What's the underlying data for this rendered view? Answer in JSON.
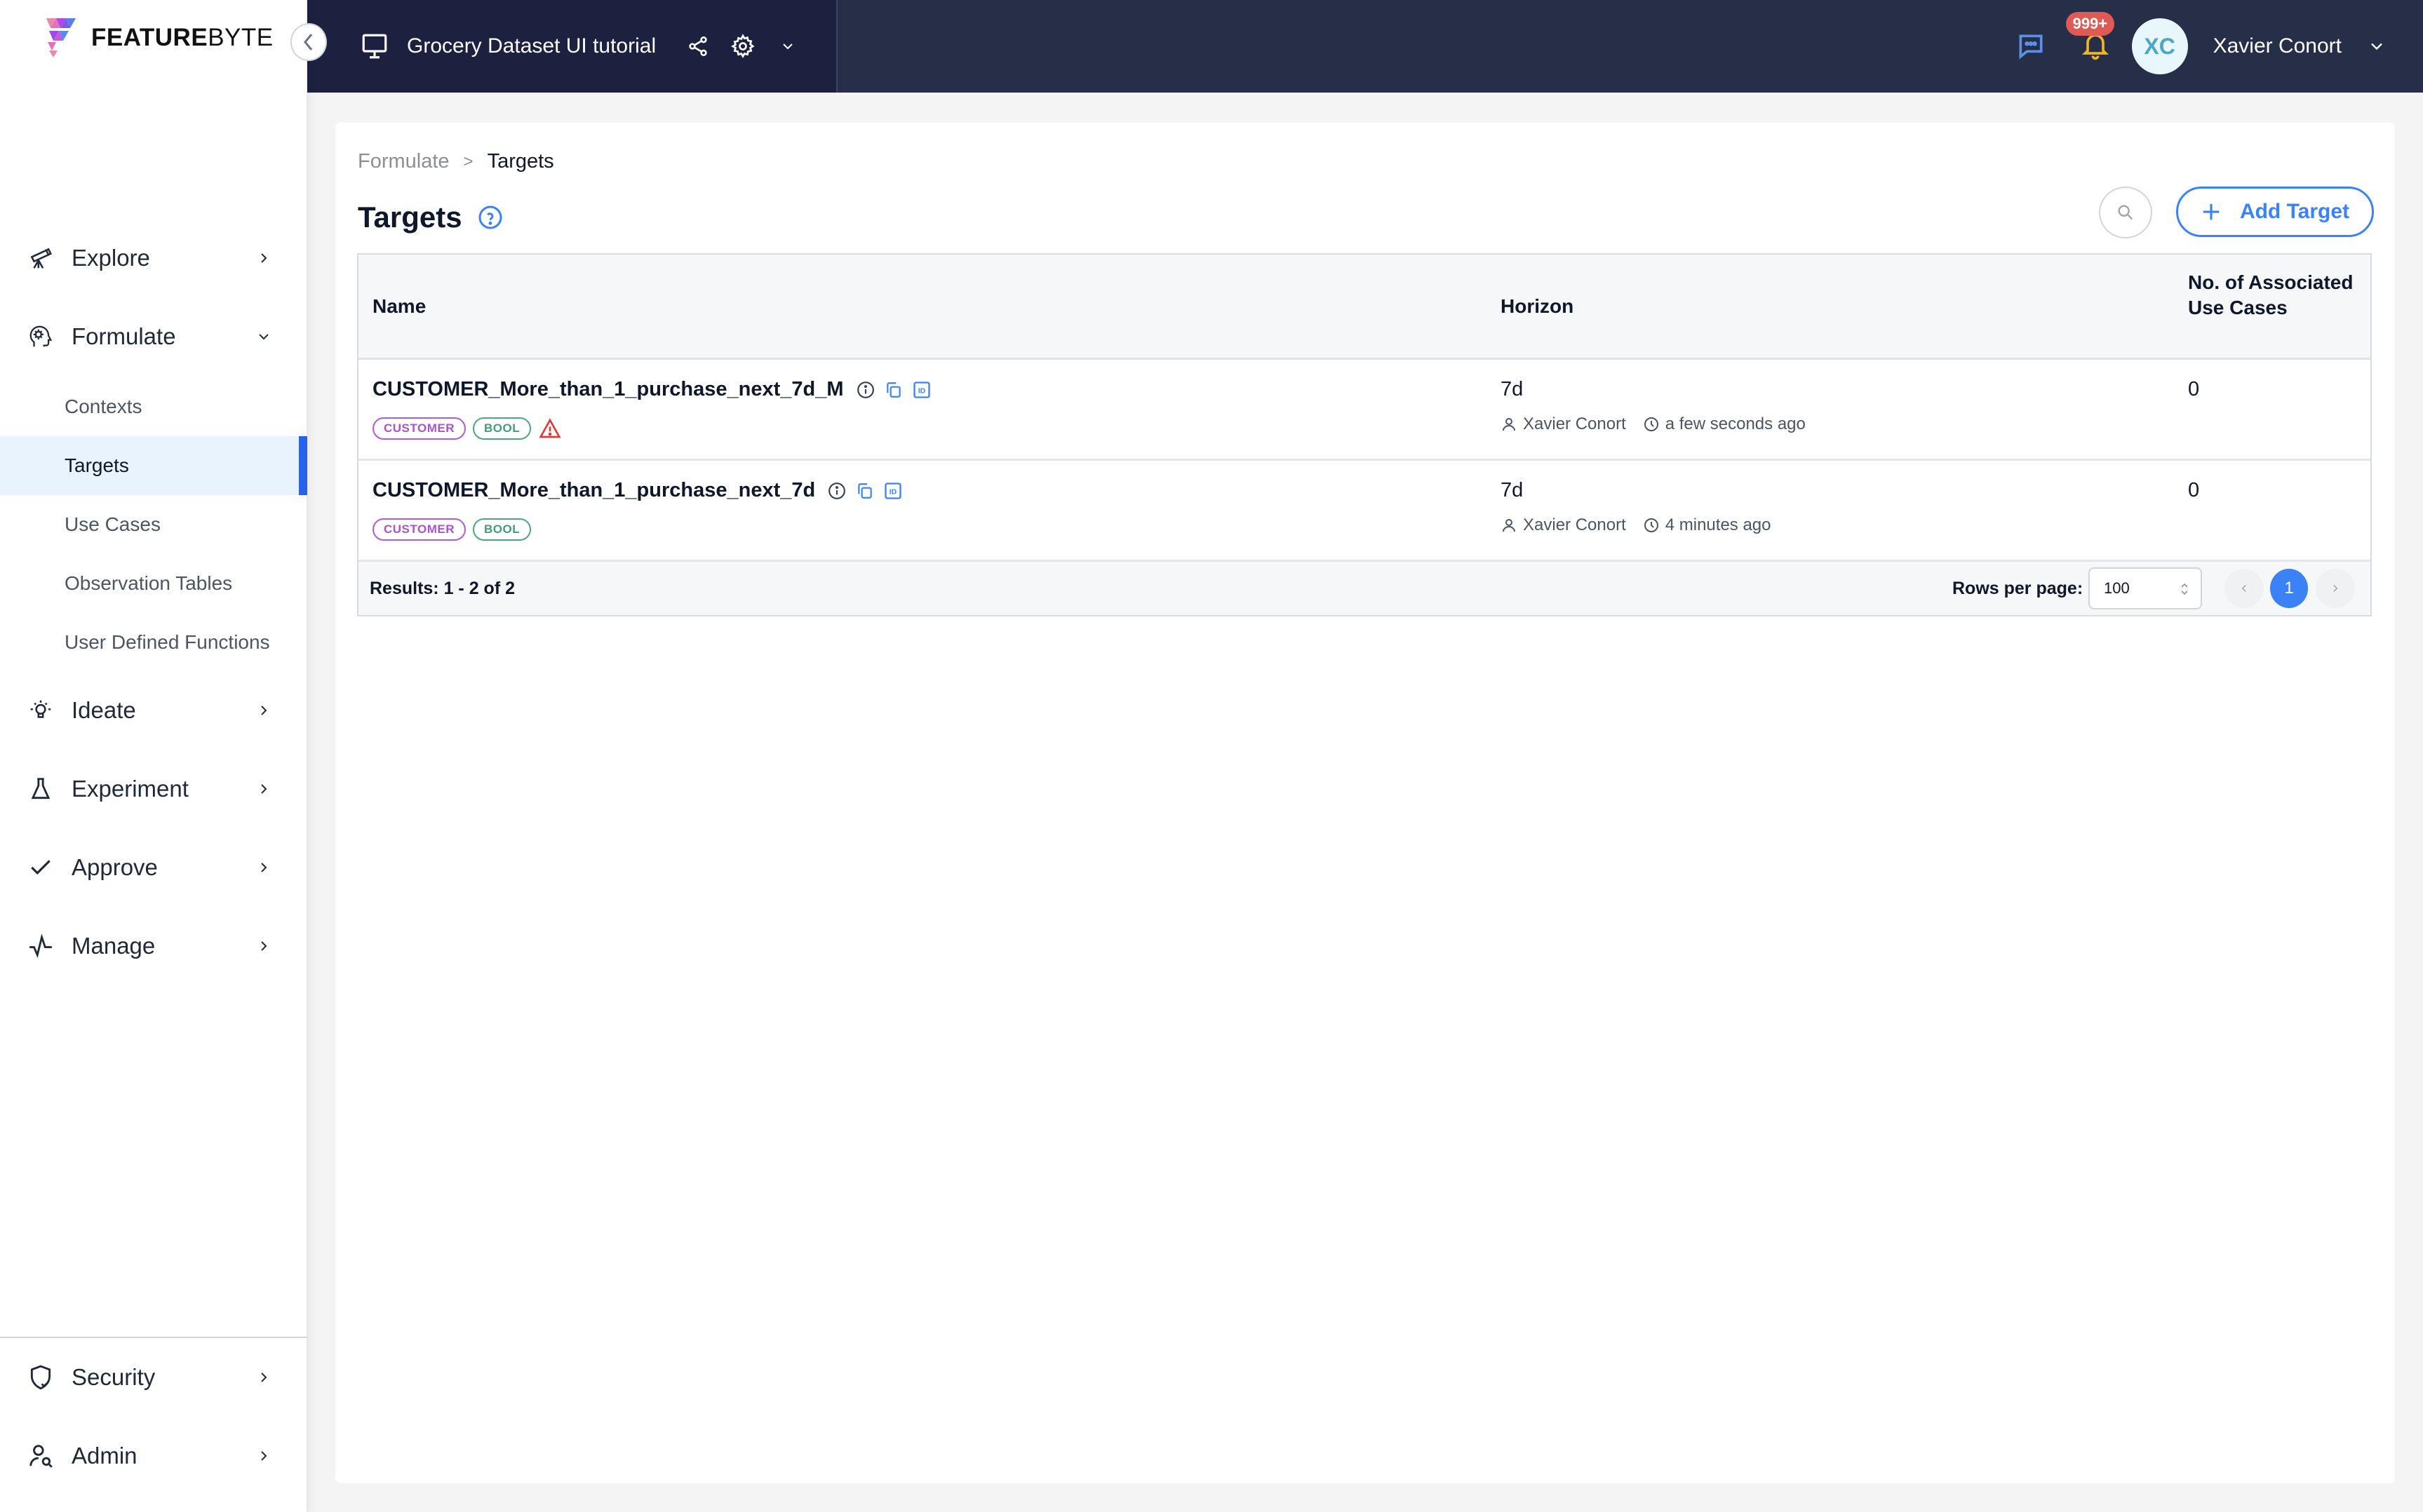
{
  "brand": {
    "name_bold": "FEATURE",
    "name_light": "BYTE"
  },
  "header": {
    "project_title": "Grocery Dataset UI tutorial",
    "notification_count": "999+",
    "user_initials": "XC",
    "user_name": "Xavier Conort"
  },
  "sidebar": {
    "items": [
      {
        "label": "Explore",
        "icon": "telescope-icon"
      },
      {
        "label": "Formulate",
        "icon": "head-gear-icon",
        "expanded": true,
        "children": [
          {
            "label": "Contexts"
          },
          {
            "label": "Targets",
            "active": true
          },
          {
            "label": "Use Cases"
          },
          {
            "label": "Observation Tables"
          },
          {
            "label": "User Defined Functions"
          }
        ]
      },
      {
        "label": "Ideate",
        "icon": "lightbulb-icon"
      },
      {
        "label": "Experiment",
        "icon": "flask-icon"
      },
      {
        "label": "Approve",
        "icon": "check-icon"
      },
      {
        "label": "Manage",
        "icon": "pulse-icon"
      }
    ],
    "bottom_items": [
      {
        "label": "Security",
        "icon": "shield-check-icon"
      },
      {
        "label": "Admin",
        "icon": "user-search-icon"
      }
    ]
  },
  "main": {
    "breadcrumb": {
      "parent": "Formulate",
      "separator": ">",
      "current": "Targets"
    },
    "title": "Targets",
    "add_button_label": "Add Target",
    "table": {
      "columns": [
        "Name",
        "Horizon",
        "No. of Associated Use Cases"
      ],
      "rows": [
        {
          "name": "CUSTOMER_More_than_1_purchase_next_7d_M",
          "tags": [
            "CUSTOMER",
            "BOOL"
          ],
          "warning": true,
          "horizon": "7d",
          "author": "Xavier Conort",
          "time": "a few seconds ago",
          "use_cases": "0"
        },
        {
          "name": "CUSTOMER_More_than_1_purchase_next_7d",
          "tags": [
            "CUSTOMER",
            "BOOL"
          ],
          "warning": false,
          "horizon": "7d",
          "author": "Xavier Conort",
          "time": "4 minutes ago",
          "use_cases": "0"
        }
      ],
      "footer": {
        "results": "Results: 1 - 2 of 2",
        "rows_per_page_label": "Rows per page:",
        "rows_per_page_value": "100",
        "current_page": "1"
      }
    }
  },
  "colors": {
    "accent": "#3b82f6",
    "header_dark": "#1c2140",
    "header": "#272e48",
    "active_bg": "#e8f3fd",
    "customer_tag": "#a855c7",
    "bool_tag": "#3f9f76",
    "warning": "#dc3b35",
    "badge": "#e05a55"
  }
}
